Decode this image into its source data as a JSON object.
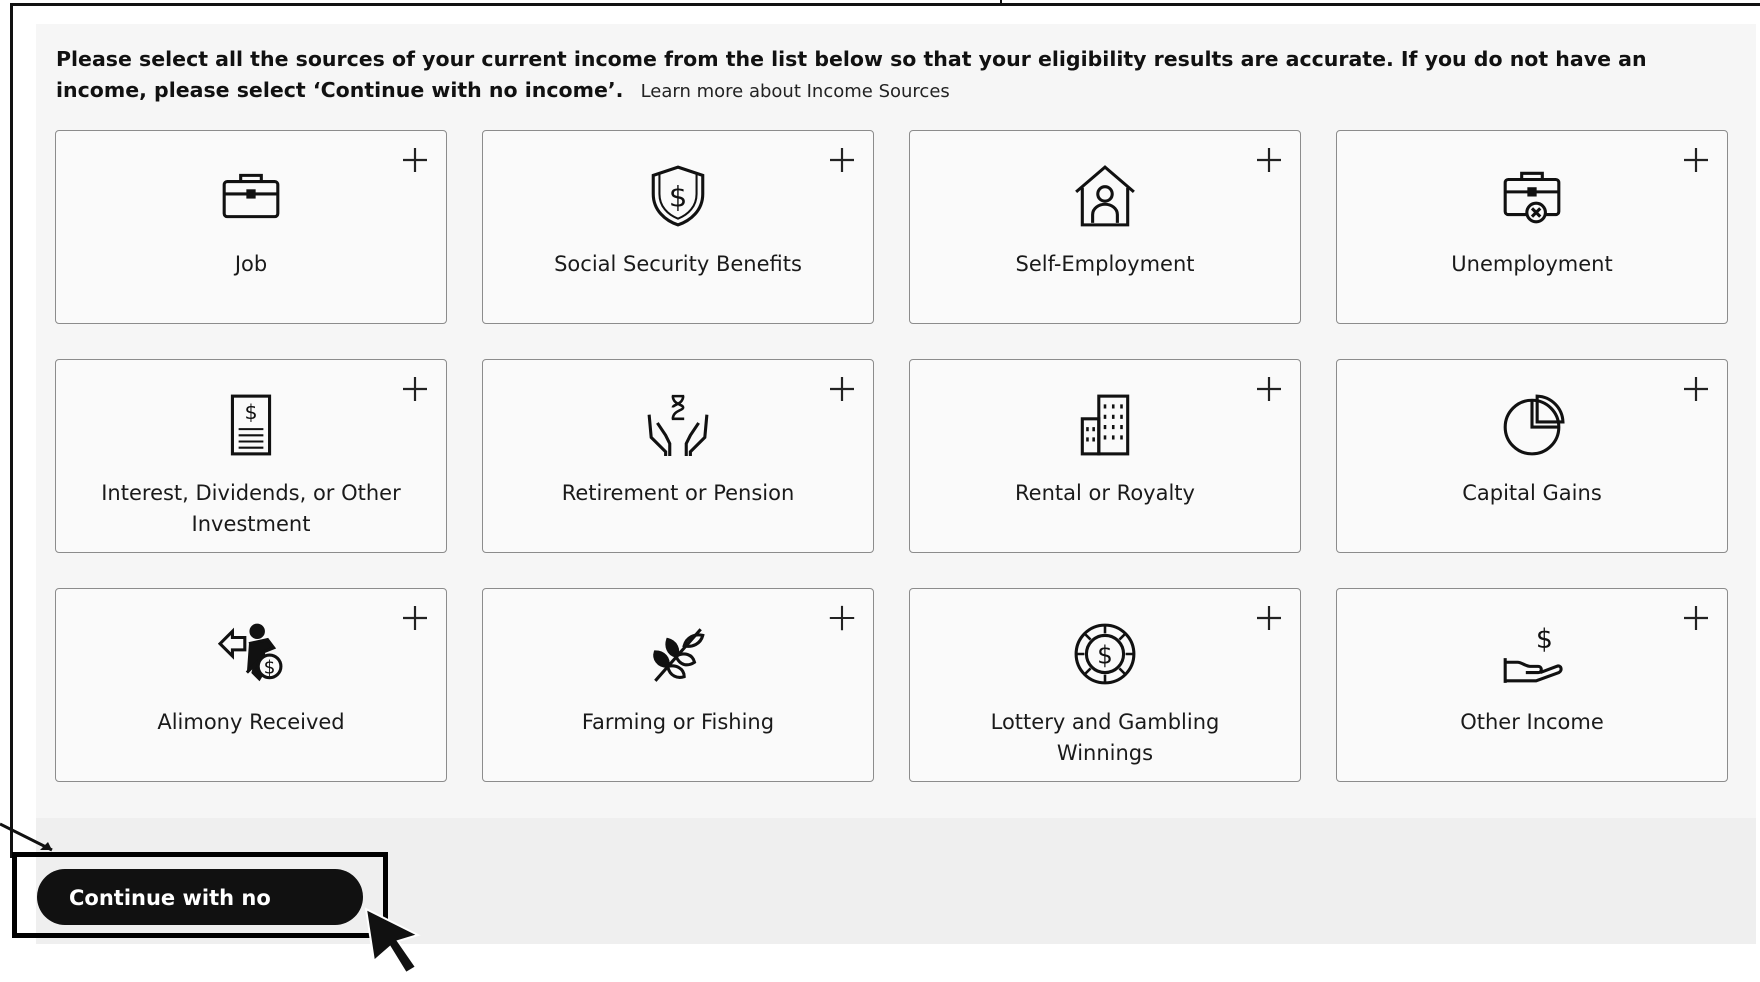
{
  "intro": {
    "text": "Please select all the sources of your current income from the list below so that your eligibility results are accurate. If you do not have an income, please select ‘Continue with no income’.",
    "learn_more": "Learn more about Income Sources"
  },
  "cards": [
    {
      "label": "Job",
      "icon": "briefcase-icon"
    },
    {
      "label": "Social Security Benefits",
      "icon": "shield-dollar-icon"
    },
    {
      "label": "Self-Employment",
      "icon": "house-person-icon"
    },
    {
      "label": "Unemployment",
      "icon": "briefcase-x-icon"
    },
    {
      "label": "Interest, Dividends, or Other Investment",
      "icon": "dollar-document-icon"
    },
    {
      "label": "Retirement or Pension",
      "icon": "hands-hourglass-icon"
    },
    {
      "label": "Rental or Royalty",
      "icon": "buildings-icon"
    },
    {
      "label": "Capital Gains",
      "icon": "pie-chart-icon"
    },
    {
      "label": "Alimony Received",
      "icon": "person-dollar-arrow-icon"
    },
    {
      "label": "Farming or Fishing",
      "icon": "wheat-icon"
    },
    {
      "label": "Lottery and Gambling Winnings",
      "icon": "coin-dollar-icon"
    },
    {
      "label": "Other Income",
      "icon": "hand-dollar-icon"
    }
  ],
  "cta": {
    "label": "Continue with no income"
  },
  "colors": {
    "button_bg": "#111111",
    "card_border": "#8c8c8c",
    "panel_bg": "#f6f6f6"
  }
}
